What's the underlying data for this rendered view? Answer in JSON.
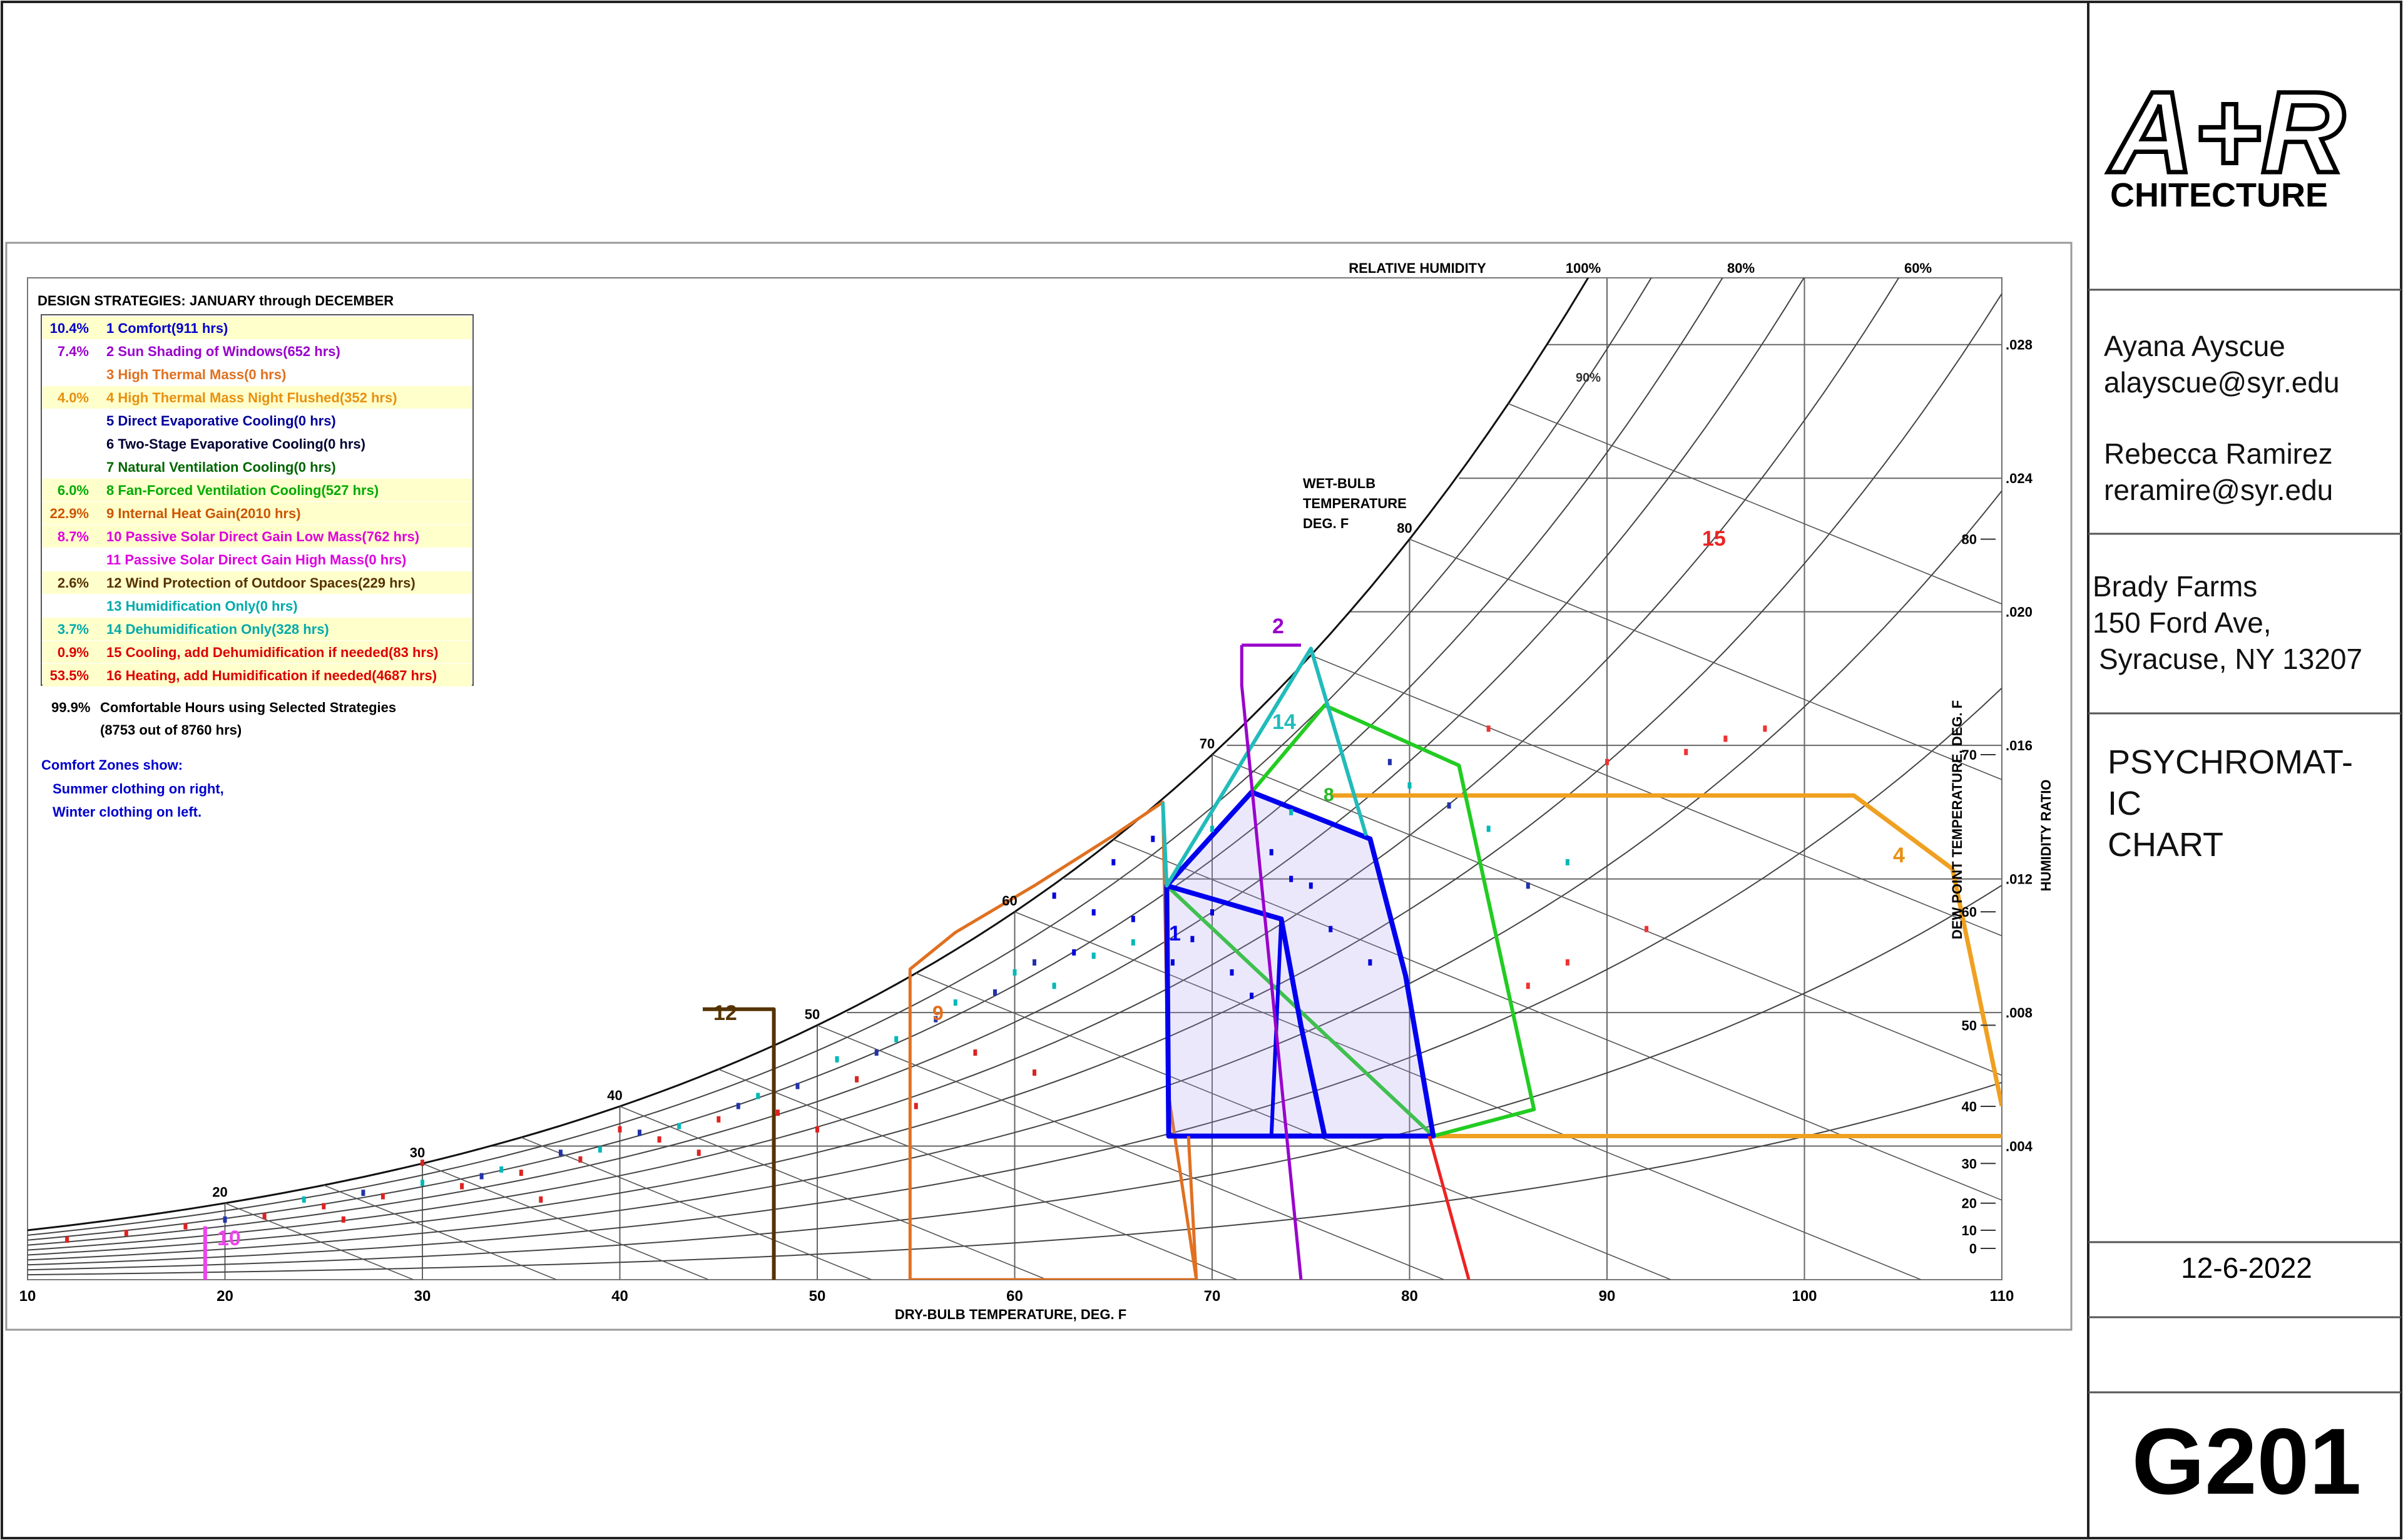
{
  "title_block": {
    "logo_line1": "A+R",
    "logo_line2": "CHITECTURE",
    "author1_name": "Ayana Ayscue",
    "author1_email": "alayscue@syr.edu",
    "author2_name": "Rebecca Ramirez",
    "author2_email": "reramire@syr.edu",
    "project_name": "Brady Farms",
    "address_line1": "150 Ford Ave,",
    "address_line2": "Syracuse, NY 13207",
    "drawing_title_lines": [
      "PSYCHROMAT-",
      "IC",
      "CHART"
    ],
    "date": "12-6-2022",
    "sheet_number": "G201"
  },
  "legend": {
    "heading": "DESIGN STRATEGIES:  JANUARY through DECEMBER",
    "items": [
      {
        "pct": "10.4%",
        "label": "1 Comfort(911 hrs)",
        "color": "#0000cc",
        "bg": "#ffffcc"
      },
      {
        "pct": "7.4%",
        "label": "2 Sun Shading of Windows(652 hrs)",
        "color": "#9900cc",
        "bg": "#ffffff"
      },
      {
        "pct": "",
        "label": "3 High Thermal Mass(0 hrs)",
        "color": "#e07020",
        "bg": "#ffffff"
      },
      {
        "pct": "4.0%",
        "label": "4 High Thermal Mass Night Flushed(352 hrs)",
        "color": "#e89010",
        "bg": "#ffffcc"
      },
      {
        "pct": "",
        "label": "5 Direct Evaporative Cooling(0 hrs)",
        "color": "#000099",
        "bg": "#ffffff"
      },
      {
        "pct": "",
        "label": "6 Two-Stage Evaporative Cooling(0 hrs)",
        "color": "#000033",
        "bg": "#ffffff"
      },
      {
        "pct": "",
        "label": "7 Natural Ventilation Cooling(0 hrs)",
        "color": "#006600",
        "bg": "#ffffff"
      },
      {
        "pct": "6.0%",
        "label": "8 Fan-Forced Ventilation Cooling(527 hrs)",
        "color": "#00aa00",
        "bg": "#ffffcc"
      },
      {
        "pct": "22.9%",
        "label": "9 Internal Heat Gain(2010 hrs)",
        "color": "#cc5500",
        "bg": "#ffffcc"
      },
      {
        "pct": "8.7%",
        "label": "10 Passive Solar Direct Gain Low Mass(762 hrs)",
        "color": "#dd00dd",
        "bg": "#ffffcc"
      },
      {
        "pct": "",
        "label": "11 Passive Solar Direct Gain High Mass(0 hrs)",
        "color": "#dd00dd",
        "bg": "#ffffff"
      },
      {
        "pct": "2.6%",
        "label": "12 Wind Protection of Outdoor Spaces(229 hrs)",
        "color": "#553300",
        "bg": "#ffffcc"
      },
      {
        "pct": "",
        "label": "13 Humidification Only(0 hrs)",
        "color": "#00aaaa",
        "bg": "#ffffff"
      },
      {
        "pct": "3.7%",
        "label": "14 Dehumidification Only(328 hrs)",
        "color": "#00aaaa",
        "bg": "#ffffcc"
      },
      {
        "pct": "0.9%",
        "label": "15 Cooling, add Dehumidification if needed(83 hrs)",
        "color": "#dd0000",
        "bg": "#ffffcc"
      },
      {
        "pct": "53.5%",
        "label": "16 Heating, add Humidification if needed(4687 hrs)",
        "color": "#dd0000",
        "bg": "#ffffcc"
      }
    ],
    "summary_pct": "99.9%",
    "summary_line1": "Comfortable Hours using Selected Strategies",
    "summary_line2": "(8753 out of 8760 hrs)",
    "note_line1": "Comfort Zones show:",
    "note_line2": "Summer clothing on right,",
    "note_line3": "Winter clothing on left."
  },
  "chart_data": {
    "type": "scatter",
    "title": "",
    "xlabel": "DRY-BULB TEMPERATURE, DEG. F",
    "ylabel_right": "HUMIDITY RATIO",
    "dewpoint_label": "DEW POINT TEMPERATURE, DEG. F",
    "rh_label": "RELATIVE HUMIDITY",
    "wetbulb_label": [
      "WET-BULB",
      "TEMPERATURE",
      "DEG. F"
    ],
    "xlim": [
      10,
      110
    ],
    "ylim": [
      0,
      0.03
    ],
    "x_ticks": [
      10,
      20,
      30,
      40,
      50,
      60,
      70,
      80,
      90,
      100,
      110
    ],
    "y_ticks": [
      ".004",
      ".008",
      ".012",
      ".016",
      ".020",
      ".024",
      ".028"
    ],
    "y_tick_values": [
      0.004,
      0.008,
      0.012,
      0.016,
      0.02,
      0.024,
      0.028
    ],
    "dewpoint_ticks": [
      "0",
      "10",
      "20",
      "30",
      "40",
      "50",
      "60",
      "70",
      "80"
    ],
    "rh_curves_pct": [
      10,
      20,
      30,
      40,
      50,
      60,
      70,
      80,
      90,
      100
    ],
    "rh_labels": [
      "100%",
      "80%",
      "60%"
    ],
    "rh_inline_label": "90%",
    "wetbulb_ticks": [
      "20",
      "30",
      "40",
      "50",
      "60",
      "70",
      "80"
    ],
    "grid": true,
    "legend_position": "top-left",
    "zone_labels": [
      "1",
      "2",
      "4",
      "8",
      "9",
      "10",
      "12",
      "14",
      "15"
    ],
    "series": [
      {
        "name": "Comfort",
        "color": "#0000dd",
        "points": [
          [
            62,
            0.0115
          ],
          [
            64,
            0.011
          ],
          [
            66,
            0.0108
          ],
          [
            68,
            0.0095
          ],
          [
            70,
            0.011
          ],
          [
            72,
            0.0085
          ],
          [
            74,
            0.012
          ],
          [
            76,
            0.0105
          ],
          [
            65,
            0.0125
          ],
          [
            63,
            0.0098
          ],
          [
            67,
            0.0132
          ],
          [
            71,
            0.0092
          ],
          [
            73,
            0.0128
          ],
          [
            69,
            0.0102
          ],
          [
            75,
            0.0118
          ],
          [
            78,
            0.0095
          ]
        ]
      },
      {
        "name": "Heating",
        "color": "#dd2222",
        "points": [
          [
            12,
            0.0012
          ],
          [
            15,
            0.0014
          ],
          [
            18,
            0.0016
          ],
          [
            22,
            0.0019
          ],
          [
            25,
            0.0022
          ],
          [
            28,
            0.0025
          ],
          [
            32,
            0.0028
          ],
          [
            35,
            0.0032
          ],
          [
            38,
            0.0036
          ],
          [
            42,
            0.0042
          ],
          [
            45,
            0.0048
          ],
          [
            48,
            0.005
          ],
          [
            52,
            0.006
          ],
          [
            55,
            0.0052
          ],
          [
            58,
            0.0068
          ],
          [
            61,
            0.0062
          ],
          [
            30,
            0.0035
          ],
          [
            40,
            0.0045
          ],
          [
            44,
            0.0038
          ],
          [
            50,
            0.0045
          ],
          [
            26,
            0.0018
          ],
          [
            36,
            0.0024
          ]
        ]
      },
      {
        "name": "Internal Heat Gain",
        "color": "#00b8b8",
        "points": [
          [
            24,
            0.0024
          ],
          [
            30,
            0.0029
          ],
          [
            34,
            0.0033
          ],
          [
            39,
            0.0039
          ],
          [
            43,
            0.0046
          ],
          [
            47,
            0.0055
          ],
          [
            51,
            0.0066
          ],
          [
            54,
            0.0072
          ],
          [
            57,
            0.0083
          ],
          [
            60,
            0.0092
          ],
          [
            62,
            0.0088
          ],
          [
            64,
            0.0097
          ],
          [
            66,
            0.0101
          ],
          [
            70,
            0.0135
          ],
          [
            74,
            0.014
          ],
          [
            80,
            0.0148
          ],
          [
            84,
            0.0135
          ],
          [
            88,
            0.0125
          ]
        ]
      },
      {
        "name": "Passive Solar",
        "color": "#2233aa",
        "points": [
          [
            20,
            0.0018
          ],
          [
            27,
            0.0026
          ],
          [
            33,
            0.0031
          ],
          [
            37,
            0.0038
          ],
          [
            41,
            0.0044
          ],
          [
            46,
            0.0052
          ],
          [
            49,
            0.0058
          ],
          [
            53,
            0.0068
          ],
          [
            56,
            0.0078
          ],
          [
            59,
            0.0086
          ],
          [
            61,
            0.0095
          ],
          [
            79,
            0.0155
          ],
          [
            82,
            0.0142
          ],
          [
            86,
            0.0118
          ]
        ]
      },
      {
        "name": "Cooling",
        "color": "#ee3333",
        "points": [
          [
            84,
            0.0165
          ],
          [
            90,
            0.0155
          ],
          [
            94,
            0.0158
          ],
          [
            96,
            0.0162
          ],
          [
            98,
            0.0165
          ],
          [
            92,
            0.0105
          ],
          [
            88,
            0.0095
          ],
          [
            86,
            0.0088
          ]
        ]
      }
    ]
  }
}
